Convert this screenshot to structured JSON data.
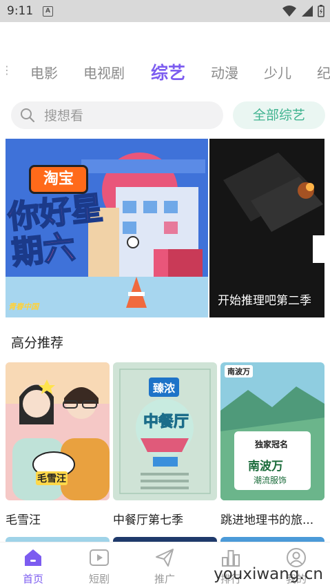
{
  "status_bar": {
    "time": "9:11",
    "notification_letter": "A"
  },
  "tabs": [
    {
      "label": "电影",
      "active": false
    },
    {
      "label": "电视剧",
      "active": false
    },
    {
      "label": "综艺",
      "active": true
    },
    {
      "label": "动漫",
      "active": false
    },
    {
      "label": "少儿",
      "active": false
    },
    {
      "label": "纪",
      "active": false
    }
  ],
  "search": {
    "placeholder": "搜想看",
    "all_button": "全部综艺"
  },
  "banners": [
    {
      "logo": "淘宝",
      "title_art": "你好星期六",
      "corner_text": "青春中国"
    },
    {
      "caption": "开始推理吧第二季"
    }
  ],
  "section": {
    "title": "高分推荐"
  },
  "cards": [
    {
      "title": "毛雪汪",
      "poster_text": "毛雪汪"
    },
    {
      "title": "中餐厅第七季",
      "poster_text": "中餐厅",
      "sponsor": "臻浓"
    },
    {
      "title": "跳进地理书的旅...",
      "poster_text": "南波万",
      "sponsor_label": "独家冠名",
      "slogan": "潮流服饰"
    }
  ],
  "bottom_nav": [
    {
      "label": "首页",
      "icon": "home-icon",
      "active": true
    },
    {
      "label": "短剧",
      "icon": "play-icon",
      "active": false
    },
    {
      "label": "推广",
      "icon": "send-icon",
      "active": false
    },
    {
      "label": "排行",
      "icon": "chart-icon",
      "active": false
    },
    {
      "label": "我的",
      "icon": "user-icon",
      "active": false
    }
  ],
  "watermark": "youxiwang.cn",
  "colors": {
    "accent": "#7c5cf0",
    "green": "#3fb38f",
    "status_bar": "#d9d9d9"
  }
}
